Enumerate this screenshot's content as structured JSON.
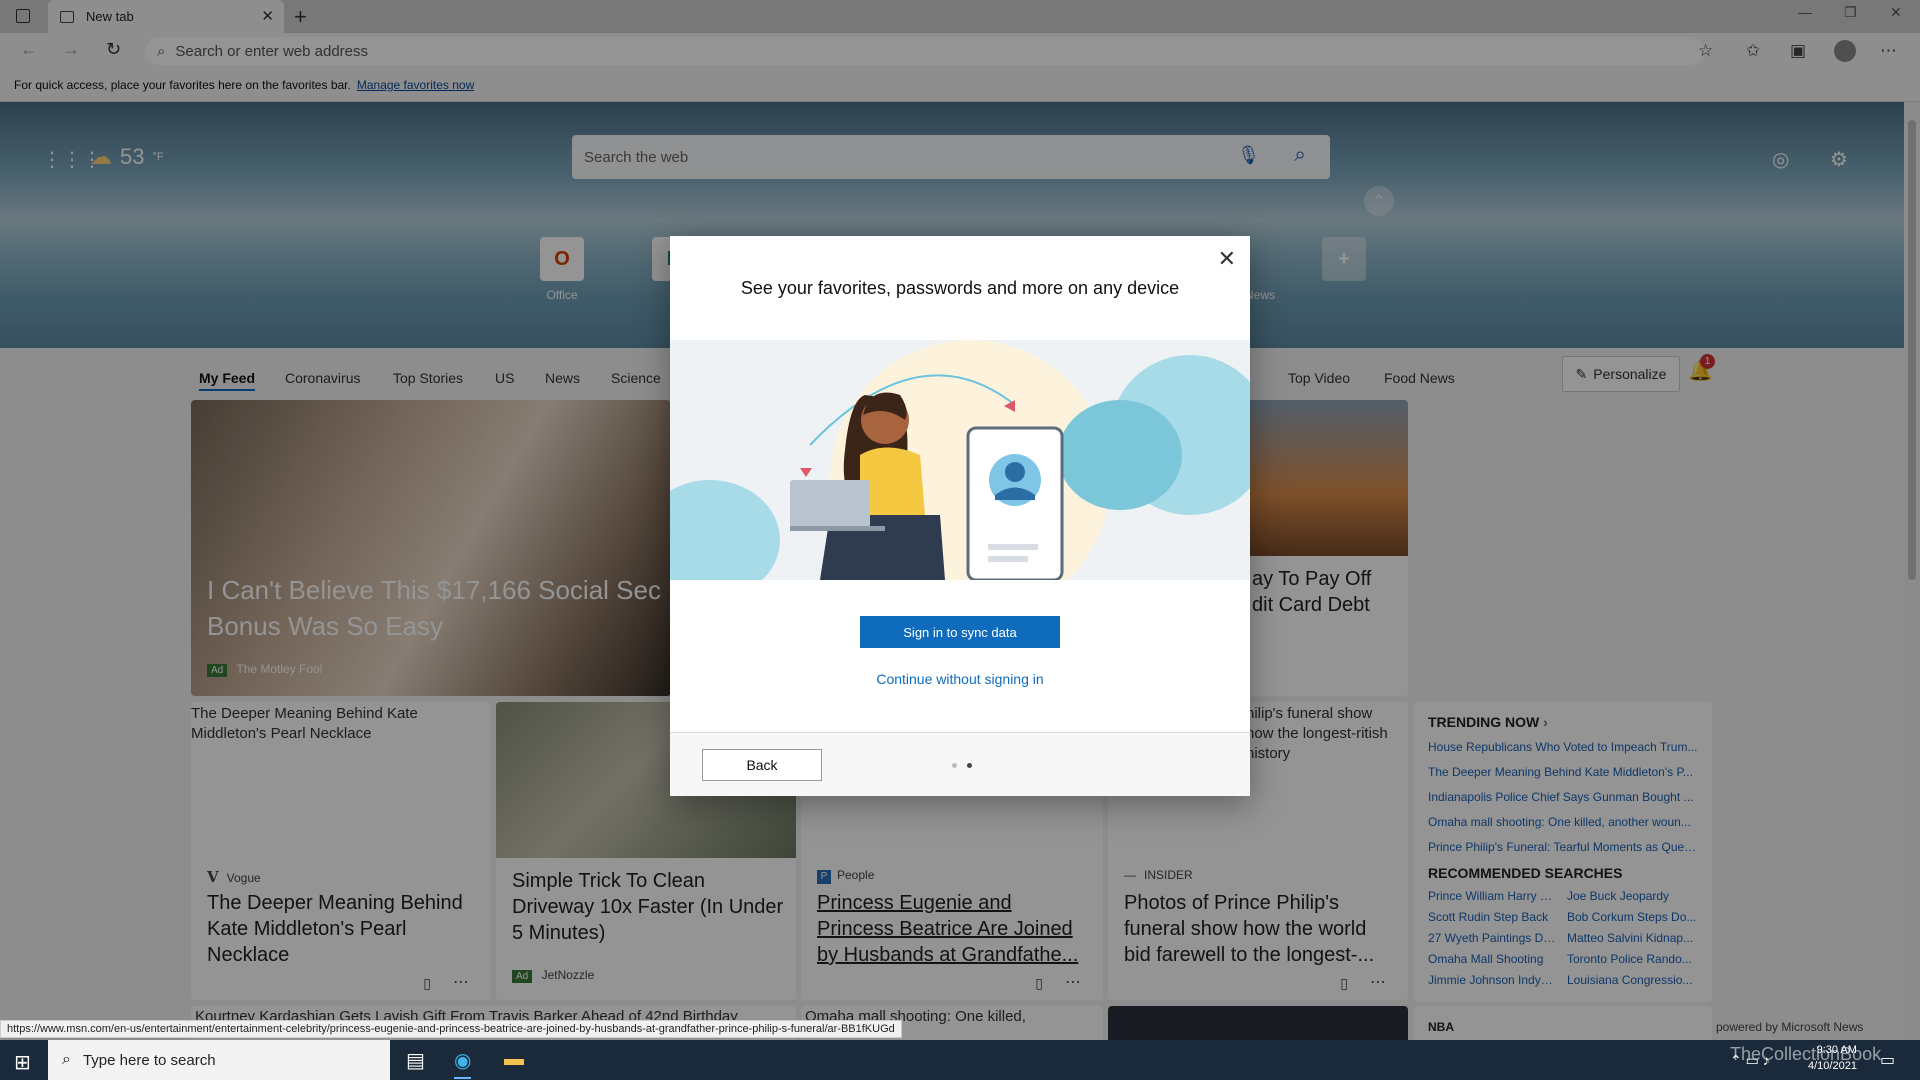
{
  "browser": {
    "tab_title": "New tab",
    "address_placeholder": "Search or enter web address",
    "favbar_text": "For quick access, place your favorites here on the favorites bar.",
    "favbar_link": "Manage favorites now"
  },
  "newtab": {
    "temperature": "53",
    "temp_unit": "°F",
    "search_placeholder": "Search the web",
    "quicklinks": [
      {
        "label": "Office"
      },
      {
        "label": "B"
      },
      {
        "label": "News"
      }
    ],
    "feed_tabs": [
      "My Feed",
      "Coronavirus",
      "Top Stories",
      "US",
      "News",
      "Science",
      "Top Video",
      "Food News"
    ],
    "personalize_label": "Personalize",
    "notification_count": "1"
  },
  "cards": {
    "hero_title": "I Can't Believe This $17,166 Social Security Bonus Was So Easy",
    "hero_title_visible": "I Can't Believe This $17,166 Social Sec",
    "hero_title_line2": "Bonus Was So Easy",
    "hero_source": "The Motley Fool",
    "ad_label": "Ad",
    "right_top_title_l1": "ay To Pay Off",
    "right_top_title_l2": "dit Card Debt",
    "vogue_alt": "The Deeper Meaning Behind Kate Middleton's Pearl Necklace",
    "vogue_source": "Vogue",
    "vogue_title": "The Deeper Meaning Behind Kate Middleton's Pearl Necklace",
    "driveway_title": "Simple Trick To Clean Driveway 10x Faster (In Under 5 Minutes)",
    "driveway_source": "JetNozzle",
    "people_source": "People",
    "people_title": "Princess Eugenie and Princess Beatrice Are Joined by Husbands at Grandfathe...",
    "philip_alt": "hilip's funeral show how the longest-ritish history",
    "insider_source": "INSIDER",
    "insider_title": "Photos of Prince Philip's funeral show how the world bid farewell to the longest-...",
    "bottom1": "Kourtney Kardashian Gets Lavish Gift From Travis Barker Ahead of 42nd Birthday",
    "bottom2": "Omaha mall shooting: One killed,",
    "nba_label": "NBA",
    "powered_by": "powered by Microsoft News"
  },
  "trending": {
    "heading": "TRENDING NOW",
    "links": [
      "House Republicans Who Voted to Impeach Trum...",
      "The Deeper Meaning Behind Kate Middleton's P...",
      "Indianapolis Police Chief Says Gunman Bought ...",
      "Omaha mall shooting: One killed, another woun...",
      "Prince Philip's Funeral: Tearful Moments as Quee..."
    ],
    "rec_heading": "RECOMMENDED SEARCHES",
    "rec": [
      "Prince William Harry Fu...",
      "Joe Buck Jeopardy",
      "Scott Rudin Step Back",
      "Bob Corkum Steps Do...",
      "27 Wyeth Paintings Do...",
      "Matteo Salvini Kidnap...",
      "Omaha Mall Shooting",
      "Toronto Police Rando...",
      "Jimmie Johnson IndyCa...",
      "Louisiana Congressio..."
    ]
  },
  "dialog": {
    "title": "See your favorites, passwords and more on any device",
    "signin_label": "Sign in to sync data",
    "continue_label": "Continue without signing in",
    "back_label": "Back",
    "page_count": 2,
    "current_page": 2
  },
  "status_url": "https://www.msn.com/en-us/entertainment/entertainment-celebrity/princess-eugenie-and-princess-beatrice-are-joined-by-husbands-at-grandfather-prince-philip-s-funeral/ar-BB1fKUGd",
  "taskbar": {
    "search_placeholder": "Type here to search",
    "time": "9:30 AM",
    "date": "4/10/2021",
    "watermark": "TheCollectionBook"
  },
  "colors": {
    "accent": "#0f6cbd",
    "link": "#1a5fb4",
    "taskbar": "#1b2a3a"
  }
}
